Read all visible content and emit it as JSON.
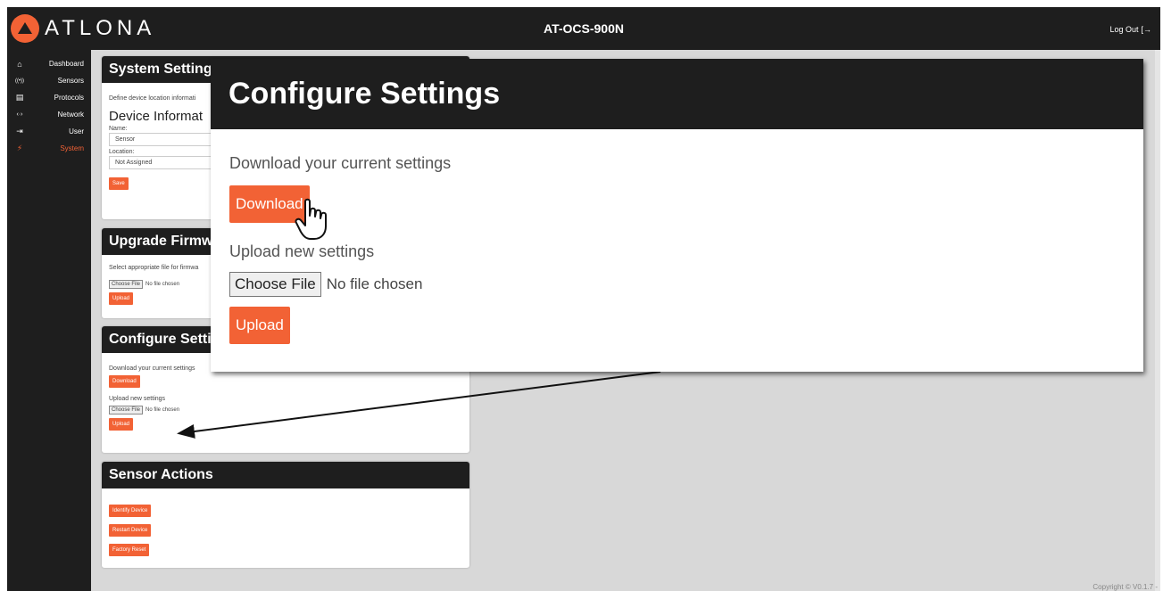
{
  "header": {
    "logo_text": "ATLONA",
    "device_title": "AT-OCS-900N",
    "logout_label": "Log Out"
  },
  "sidebar": {
    "items": [
      {
        "label": "Dashboard",
        "icon": "home-icon",
        "glyph": "⌂"
      },
      {
        "label": "Sensors",
        "icon": "sensor-icon",
        "glyph": "((•))"
      },
      {
        "label": "Protocols",
        "icon": "server-icon",
        "glyph": "▤"
      },
      {
        "label": "Network",
        "icon": "network-icon",
        "glyph": "‹·›"
      },
      {
        "label": "User",
        "icon": "login-icon",
        "glyph": "⇥"
      },
      {
        "label": "System",
        "icon": "plug-icon",
        "glyph": "⚡"
      }
    ],
    "active": "System"
  },
  "system_settings": {
    "title": "System Settings",
    "description": "Define device location informati",
    "section": "Device Informat",
    "name_label": "Name:",
    "name_value": "Sensor",
    "location_label": "Location:",
    "location_value": "Not Assigned",
    "save_label": "Save"
  },
  "upgrade_firmware": {
    "title": "Upgrade Firmwa",
    "description": "Select appropriate file for firmwa",
    "choose_file": "Choose File",
    "no_file": "No file chosen",
    "upload_label": "Upload"
  },
  "configure_small": {
    "title": "Configure Setti",
    "download_text": "Download your current settings",
    "download_label": "Download",
    "upload_text": "Upload new settings",
    "choose_file": "Choose File",
    "no_file": "No file chosen",
    "upload_label": "Upload"
  },
  "sensor_actions": {
    "title": "Sensor Actions",
    "identify_label": "Identify Device",
    "restart_label": "Restart Device",
    "reset_label": "Factory Reset"
  },
  "zoom": {
    "title": "Configure Settings",
    "download_text": "Download your current settings",
    "download_label": "Download",
    "upload_text": "Upload new settings",
    "choose_file": "Choose File",
    "no_file": "No file chosen",
    "upload_label": "Upload"
  },
  "footer": {
    "copyright": "Copyright © V0.1.7 -"
  },
  "colors": {
    "accent": "#f26235",
    "dark": "#1e1e1e",
    "background": "#d8d8d8"
  }
}
